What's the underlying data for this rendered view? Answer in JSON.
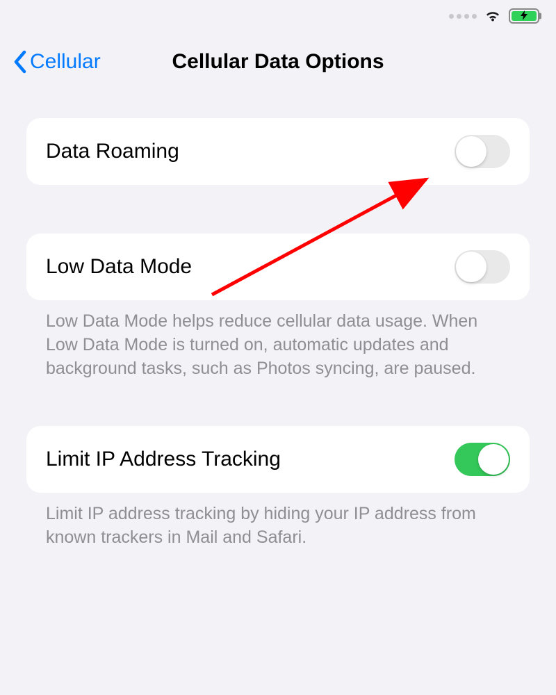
{
  "nav": {
    "back_label": "Cellular",
    "title": "Cellular Data Options"
  },
  "settings": {
    "data_roaming": {
      "label": "Data Roaming",
      "on": false
    },
    "low_data_mode": {
      "label": "Low Data Mode",
      "on": false,
      "footer": "Low Data Mode helps reduce cellular data usage. When Low Data Mode is turned on, automatic updates and background tasks, such as Photos syncing, are paused."
    },
    "limit_ip_tracking": {
      "label": "Limit IP Address Tracking",
      "on": true,
      "footer": "Limit IP address tracking by hiding your IP address from known trackers in Mail and Safari."
    }
  }
}
